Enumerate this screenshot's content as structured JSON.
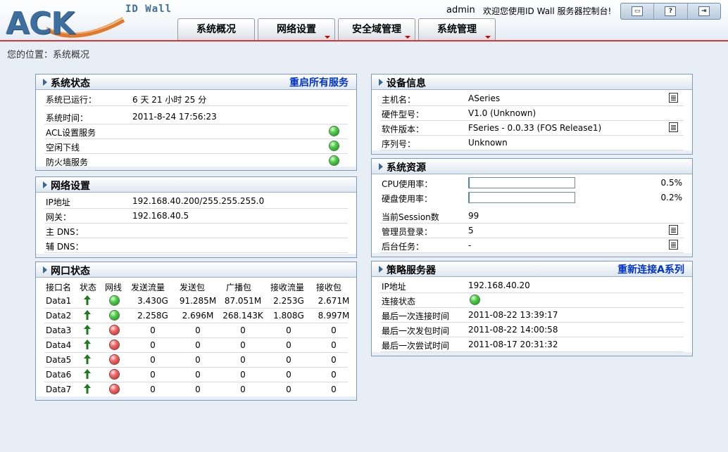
{
  "header": {
    "logo_text": "ACK",
    "product": "ID Wall",
    "user": "admin",
    "welcome": "欢迎您使用ID Wall 服务器控制台!",
    "toolbar": [
      {
        "icon": "window-icon",
        "glyph": "▭"
      },
      {
        "icon": "help-icon",
        "glyph": "?"
      },
      {
        "icon": "logout-icon",
        "glyph": "⇥"
      }
    ],
    "nav": [
      {
        "label": "系统概况",
        "dropdown": false
      },
      {
        "label": "网络设置",
        "dropdown": true
      },
      {
        "label": "安全域管理",
        "dropdown": true
      },
      {
        "label": "系统管理",
        "dropdown": true
      }
    ]
  },
  "breadcrumb": "您的位置：系统概况",
  "colors": {
    "accent": "#3d6e9d",
    "link": "#0033cc",
    "header_line": "#dd3333"
  },
  "system_status": {
    "title": "系统状态",
    "action": "重启所有服务",
    "uptime_label": "系统已运行：",
    "uptime_value": "6 天 21 小时 25 分",
    "time_label": "系统时间：",
    "time_value": "2011-8-24 17:56:23",
    "services": [
      {
        "label": "ACL设置服务",
        "status": "green"
      },
      {
        "label": "空闲下线",
        "status": "green"
      },
      {
        "label": "防火墙服务",
        "status": "green"
      }
    ]
  },
  "network": {
    "title": "网络设置",
    "rows": [
      {
        "label": "IP地址",
        "value": "192.168.40.200/255.255.255.0"
      },
      {
        "label": "网关：",
        "value": "192.168.40.5"
      },
      {
        "label": "主 DNS：",
        "value": ""
      },
      {
        "label": "辅 DNS：",
        "value": ""
      }
    ]
  },
  "ports": {
    "title": "网口状态",
    "headers": [
      "接口名",
      "状态",
      "网线",
      "发送流量",
      "发送包",
      "广播包",
      "接收流量",
      "接收包"
    ],
    "rows": [
      {
        "name": "Data1",
        "cable": "green",
        "tx": "3.430G",
        "txp": "91.285M",
        "bc": "87.051M",
        "rx": "2.253G",
        "rxp": "2.671M"
      },
      {
        "name": "Data2",
        "cable": "green",
        "tx": "2.258G",
        "txp": "2.696M",
        "bc": "268.143K",
        "rx": "1.808G",
        "rxp": "8.997M"
      },
      {
        "name": "Data3",
        "cable": "red",
        "tx": "0",
        "txp": "0",
        "bc": "0",
        "rx": "0",
        "rxp": "0"
      },
      {
        "name": "Data4",
        "cable": "red",
        "tx": "0",
        "txp": "0",
        "bc": "0",
        "rx": "0",
        "rxp": "0"
      },
      {
        "name": "Data5",
        "cable": "red",
        "tx": "0",
        "txp": "0",
        "bc": "0",
        "rx": "0",
        "rxp": "0"
      },
      {
        "name": "Data6",
        "cable": "red",
        "tx": "0",
        "txp": "0",
        "bc": "0",
        "rx": "0",
        "rxp": "0"
      },
      {
        "name": "Data7",
        "cable": "red",
        "tx": "0",
        "txp": "0",
        "bc": "0",
        "rx": "0",
        "rxp": "0"
      }
    ]
  },
  "device": {
    "title": "设备信息",
    "rows": [
      {
        "label": "主机名：",
        "value": "ASeries",
        "icon": "edit-doc-icon"
      },
      {
        "label": "硬件型号：",
        "value": "V1.0 (Unknown)",
        "icon": ""
      },
      {
        "label": "软件版本：",
        "value": "FSeries - 0.0.33 (FOS Release1)",
        "icon": "upgrade-doc-icon"
      },
      {
        "label": "序列号：",
        "value": "Unknown",
        "icon": ""
      }
    ]
  },
  "resources": {
    "title": "系统资源",
    "cpu_label": "CPU使用率：",
    "cpu_value": "0.5%",
    "cpu_fraction": 0.005,
    "disk_label": "硬盘使用率：",
    "disk_value": "0.2%",
    "disk_fraction": 0.002,
    "session_label": "当前Session数",
    "session_value": "99",
    "admin_label": "管理员登录：",
    "admin_value": "5",
    "task_label": "后台任务：",
    "task_value": "-"
  },
  "policy": {
    "title": "策略服务器",
    "action": "重新连接A系列",
    "ip_label": "IP地址",
    "ip_value": "192.168.40.20",
    "conn_label": "连接状态",
    "conn_status": "green",
    "last_conn_label": "最后一次连接时间",
    "last_conn_value": "2011-08-22 13:39:17",
    "last_send_label": "最后一次发包时间",
    "last_send_value": "2011-08-22 14:00:58",
    "last_try_label": "最后一次尝试时间",
    "last_try_value": "2011-08-17 20:31:32"
  }
}
